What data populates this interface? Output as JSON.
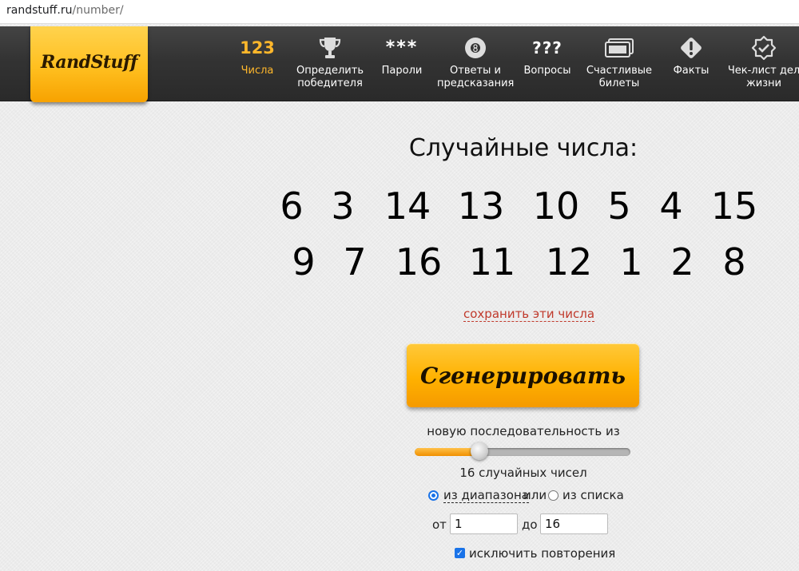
{
  "browser": {
    "url_host": "randstuff.ru",
    "url_path": "/number/"
  },
  "logo": "RandStuff",
  "nav": [
    {
      "label": "Числа",
      "icon": "numbers-icon",
      "icon_text": "123",
      "active": true
    },
    {
      "label": "Определить победителя",
      "icon": "trophy-icon"
    },
    {
      "label": "Пароли",
      "icon": "password-stars-icon",
      "icon_text": "***"
    },
    {
      "label": "Ответы и предсказания",
      "icon": "magic-8-ball-icon"
    },
    {
      "label": "Вопросы",
      "icon": "question-marks-icon",
      "icon_text": "???"
    },
    {
      "label": "Счастливые билеты",
      "icon": "tickets-icon"
    },
    {
      "label": "Факты",
      "icon": "exclamation-icon"
    },
    {
      "label": "Чек-лист дел жизни",
      "icon": "checklist-badge-icon"
    }
  ],
  "title": "Случайные числа:",
  "numbers": [
    [
      "6",
      "3",
      "14",
      "13",
      "10",
      "5",
      "4",
      "15"
    ],
    [
      "9",
      "7",
      "16",
      "11",
      "12",
      "1",
      "2",
      "8"
    ]
  ],
  "save_link": "сохранить эти числа",
  "generate_button": "Сгенерировать",
  "sequence_caption": "новую последовательность из",
  "count_caption": "16 случайных чисел",
  "slider_fraction": 0.3,
  "source": {
    "range_label": "из диапазона",
    "or": "или",
    "list_label": "из списка",
    "selected": "range"
  },
  "range": {
    "from_label": "от",
    "from_value": "1",
    "to_label": "до",
    "to_value": "16"
  },
  "exclude_repeats": {
    "label": "исключить повторения",
    "checked": true
  },
  "colors": {
    "accent": "#ffb72b",
    "nav_bg": "#333333",
    "link": "#c0392b",
    "check": "#1a73e8"
  }
}
